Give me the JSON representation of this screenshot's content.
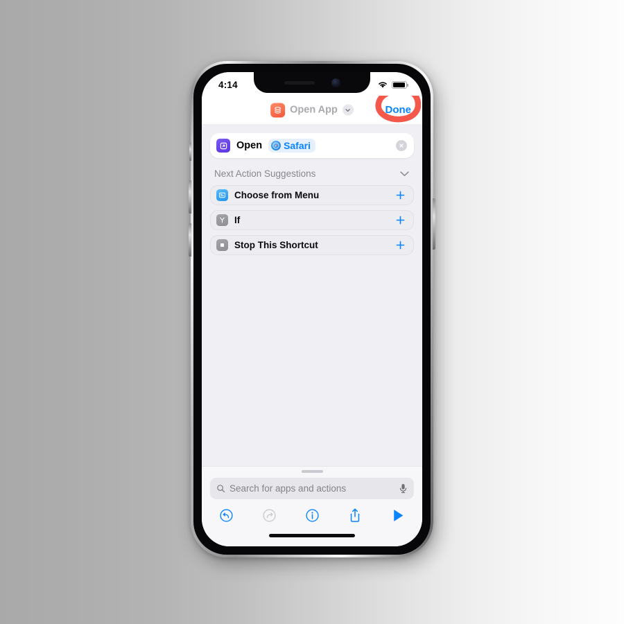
{
  "device": {
    "status_bar": {
      "time": "4:14",
      "wifi_icon": "wifi-icon",
      "battery_icon": "battery-icon"
    },
    "home_indicator": "home-indicator"
  },
  "nav": {
    "app_icon": "shortcuts-icon",
    "title": "Open App",
    "chevron_icon": "chevron-down-icon",
    "done_label": "Done",
    "annotation": "red-circle-annotation",
    "annotation_color": "#f24a3c"
  },
  "action": {
    "icon": "open-app-icon",
    "verb": "Open",
    "token_icon": "safari-icon",
    "token_label": "Safari",
    "clear_icon": "clear-icon"
  },
  "suggestions_section": {
    "header": "Next Action Suggestions",
    "collapse_icon": "chevron-down-icon",
    "items": [
      {
        "icon": "choose-from-menu-icon",
        "label": "Choose from Menu",
        "add_icon": "plus-icon"
      },
      {
        "icon": "if-icon",
        "label": "If",
        "add_icon": "plus-icon"
      },
      {
        "icon": "stop-shortcut-icon",
        "label": "Stop This Shortcut",
        "add_icon": "plus-icon"
      }
    ]
  },
  "search": {
    "icon": "search-icon",
    "placeholder": "Search for apps and actions",
    "mic_icon": "microphone-icon"
  },
  "toolbar": {
    "items": [
      {
        "name": "undo-button",
        "icon": "undo-icon",
        "state": "enabled"
      },
      {
        "name": "redo-button",
        "icon": "redo-icon",
        "state": "disabled"
      },
      {
        "name": "info-button",
        "icon": "info-icon",
        "state": "enabled"
      },
      {
        "name": "share-button",
        "icon": "share-icon",
        "state": "enabled"
      },
      {
        "name": "run-button",
        "icon": "play-icon",
        "state": "enabled"
      }
    ],
    "accent_color": "#0a84ff",
    "disabled_color": "#c4c4ca"
  }
}
